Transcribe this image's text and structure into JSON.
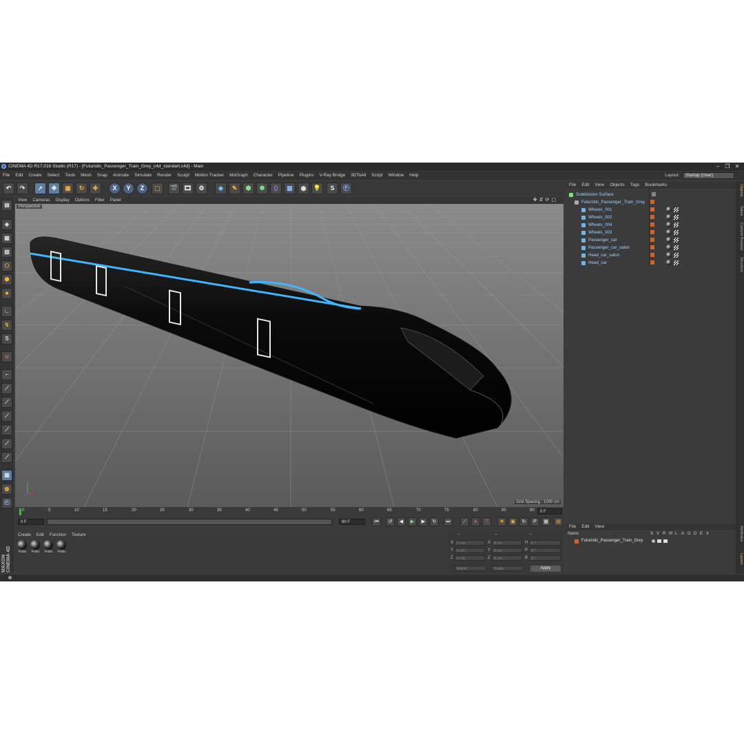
{
  "window": {
    "title": "CINEMA 4D R17.016 Studio (R17) - [Futuristic_Passenger_Train_Grey_c4d_standart.c4d] - Main",
    "controls": [
      "–",
      "❐",
      "✕"
    ]
  },
  "menubar": {
    "items": [
      "File",
      "Edit",
      "Create",
      "Select",
      "Tools",
      "Mesh",
      "Snap",
      "Animate",
      "Simulate",
      "Render",
      "Sculpt",
      "Motion Tracker",
      "MoGraph",
      "Character",
      "Pipeline",
      "Plugins",
      "V-Ray Bridge",
      "3DToAll",
      "Script",
      "Window",
      "Help"
    ],
    "layout_label": "Layout:",
    "layout_value": "Startup (User)"
  },
  "toolbar": {
    "axis_x": "X",
    "axis_y": "Y",
    "axis_z": "Z"
  },
  "viewport": {
    "menu": [
      "View",
      "Cameras",
      "Display",
      "Options",
      "Filter",
      "Panel"
    ],
    "camera_label": "Perspective",
    "grid_spacing": "Grid Spacing : 1000 cm"
  },
  "timeline": {
    "ticks": [
      "0",
      "5",
      "10",
      "15",
      "20",
      "25",
      "30",
      "35",
      "40",
      "45",
      "50",
      "55",
      "60",
      "65",
      "70",
      "75",
      "80",
      "85",
      "90"
    ],
    "current_frame": "0 F",
    "start_frame": "0 F",
    "end_frame": "90 F",
    "end_field": "90 F",
    "preview_end": "0 F"
  },
  "materials": {
    "menu": [
      "Create",
      "Edit",
      "Function",
      "Texture"
    ],
    "items": [
      "Futu",
      "Futu",
      "Futu",
      "Futu"
    ]
  },
  "coordinates": {
    "headers": [
      "--",
      "--",
      "--"
    ],
    "rows": [
      {
        "axis": "X",
        "pos": "0 cm",
        "axis2": "X",
        "size": "0 cm",
        "axis3": "H",
        "rot": "0 °"
      },
      {
        "axis": "Y",
        "pos": "0 cm",
        "axis2": "Y",
        "size": "0 cm",
        "axis3": "P",
        "rot": "0 °"
      },
      {
        "axis": "Z",
        "pos": "0 cm",
        "axis2": "Z",
        "size": "0 cm",
        "axis3": "B",
        "rot": "0 °"
      }
    ],
    "mode": "World",
    "mode2": "Scale",
    "apply": "Apply"
  },
  "objects": {
    "menu": [
      "File",
      "Edit",
      "View",
      "Objects",
      "Tags",
      "Bookmarks"
    ],
    "items": [
      {
        "label": "Subdivision Surface"
      },
      {
        "label": "Futuristic_Passenger_Train_Grey"
      },
      {
        "label": "Wheels_001"
      },
      {
        "label": "Wheels_002"
      },
      {
        "label": "Wheels_004"
      },
      {
        "label": "Wheels_003"
      },
      {
        "label": "Passenger_car"
      },
      {
        "label": "Passenger_car_salon"
      },
      {
        "label": "Head_car_salon"
      },
      {
        "label": "Head_car"
      }
    ]
  },
  "side_tabs": [
    "Objects",
    "Takes",
    "Content Browser",
    "Structure",
    "Attributes",
    "Layers"
  ],
  "layers": {
    "menu": [
      "File",
      "Edit",
      "View"
    ],
    "header_name": "Name",
    "header_flags": [
      "S",
      "V",
      "R",
      "M",
      "L",
      "A",
      "G",
      "D",
      "E",
      "X"
    ],
    "rows": [
      "Futuristic_Passenger_Train_Grey"
    ]
  },
  "branding": "MAXON CINEMA 4D",
  "colors": {
    "accent_blue": "#3fb7ff",
    "layer_orange": "#d2642a",
    "ui_dark": "#3b3b3b"
  }
}
